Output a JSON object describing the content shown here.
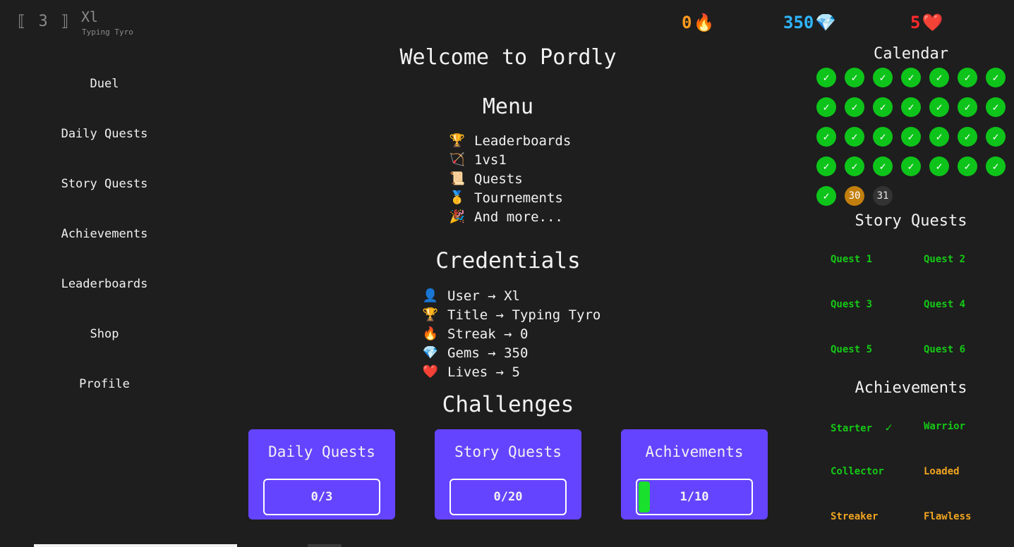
{
  "profile": {
    "level": "⟦ 3 ⟧",
    "username": "Xl",
    "title": "Typing Tyro"
  },
  "stats": {
    "streak": {
      "value": "0",
      "icon": "🔥"
    },
    "gems": {
      "value": "350",
      "icon": "💎"
    },
    "lives": {
      "value": "5",
      "icon": "❤️"
    }
  },
  "sidebar": {
    "items": [
      {
        "label": "Duel"
      },
      {
        "label": "Daily Quests"
      },
      {
        "label": "Story Quests"
      },
      {
        "label": "Achievements"
      },
      {
        "label": "Leaderboards"
      },
      {
        "label": "Shop"
      },
      {
        "label": "Profile"
      }
    ]
  },
  "main": {
    "welcome": "Welcome to Pordly",
    "menu_heading": "Menu",
    "menu_items": [
      {
        "icon": "🏆",
        "label": "Leaderboards"
      },
      {
        "icon": "🏹",
        "label": "1vs1"
      },
      {
        "icon": "📜",
        "label": "Quests"
      },
      {
        "icon": "🥇",
        "label": "Tournements"
      },
      {
        "icon": "🎉",
        "label": "And more..."
      }
    ],
    "credentials_heading": "Credentials",
    "credentials": [
      {
        "icon": "👤",
        "text": "User → Xl"
      },
      {
        "icon": "🏆",
        "text": "Title → Typing Tyro"
      },
      {
        "icon": "🔥",
        "text": "Streak → 0"
      },
      {
        "icon": "💎",
        "text": "Gems → 350"
      },
      {
        "icon": "❤️",
        "text": "Lives → 5"
      }
    ],
    "challenges_heading": "Challenges",
    "challenges": [
      {
        "title": "Daily Quests",
        "progress": "0/3",
        "fraction": 0.0
      },
      {
        "title": "Story Quests",
        "progress": "0/20",
        "fraction": 0.0
      },
      {
        "title": "Achivements",
        "progress": "1/10",
        "fraction": 0.1
      }
    ]
  },
  "calendar": {
    "heading": "Calendar",
    "completed_mark": "✓",
    "days_completed": 29,
    "today_label": "30",
    "future_label": "31"
  },
  "story_quests": {
    "heading": "Story Quests",
    "items": [
      "Quest 1",
      "Quest 2",
      "Quest 3",
      "Quest 4",
      "Quest 5",
      "Quest 6"
    ]
  },
  "achievements": {
    "heading": "Achievements",
    "items": [
      {
        "label": "Starter",
        "mark": "✓",
        "color": "#16c916"
      },
      {
        "label": "Warrior",
        "mark": "",
        "color": "#16c916"
      },
      {
        "label": "Collector",
        "mark": "",
        "color": "#16c916"
      },
      {
        "label": "Loaded",
        "mark": "",
        "color": "#f0a520"
      },
      {
        "label": "Streaker",
        "mark": "",
        "color": "#f0a520"
      },
      {
        "label": "Flawless",
        "mark": "",
        "color": "#f0a520"
      }
    ]
  },
  "colors": {
    "accent": "#6544ff",
    "success": "#0ec41a",
    "today": "#c27f0d"
  }
}
